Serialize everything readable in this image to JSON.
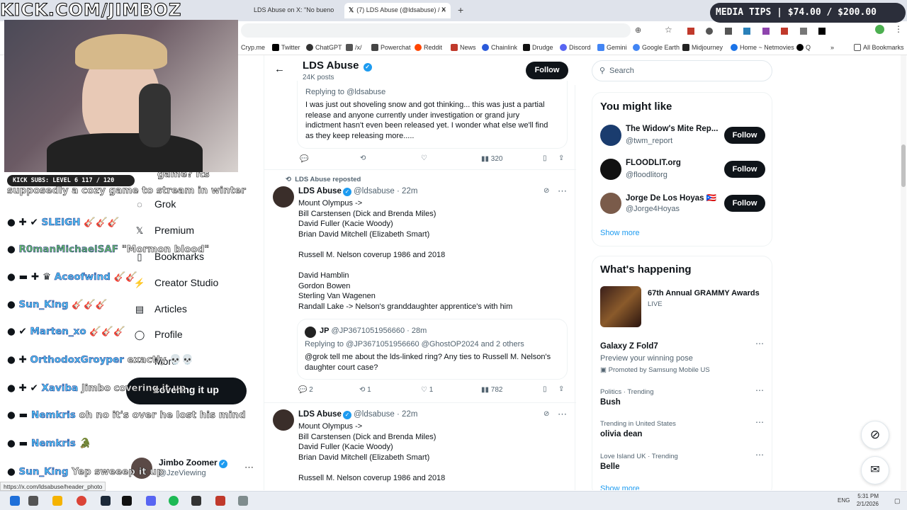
{
  "stream": {
    "title": "KICK.COM/JIMBOZ",
    "sub_goal": "KICK SUBS: LEVEL 6 117 / 120",
    "media_tips": "MEDIA TIPS | $74.00 / $200.00",
    "chat": [
      {
        "user": "",
        "msg": "supposedly a cozy game to stream in winter"
      },
      {
        "user": "SLEIGH",
        "msg": ""
      },
      {
        "user": "R0manMichaelSAF",
        "msg": "\"Mormon blood\""
      },
      {
        "user": "Aceofwind",
        "msg": ""
      },
      {
        "user": "Sun_King",
        "msg": ""
      },
      {
        "user": "Marten_xo",
        "msg": ""
      },
      {
        "user": "OrthodoxGroyper",
        "msg": "exactly 💀💀"
      },
      {
        "user": "Xaviba",
        "msg": "Jimbo covering it up"
      },
      {
        "user": "Nemkris",
        "msg": "oh no it's over he lost his mind"
      },
      {
        "user": "Nemkris",
        "msg": ""
      },
      {
        "user": "Sun_King",
        "msg": "Yep sweeep it up"
      }
    ],
    "chat_extra": "game? its",
    "pill": "covering it up"
  },
  "browser": {
    "tabs": [
      {
        "label": "LDS Abuse on X: \"No bueno"
      },
      {
        "label": "(7) LDS Abuse (@ldsabuse) / X"
      }
    ],
    "bookmarks": [
      "Cryp.me",
      "Twitter",
      "ChatGPT",
      "/x/",
      "Powerchat",
      "Reddit",
      "News",
      "Chainlink",
      "Drudge",
      "Discord",
      "Gemini",
      "Google Earth",
      "Midjourney",
      "Home ~ Netmovies",
      "Q",
      "All Bookmarks"
    ],
    "status_url": "https://x.com/ldsabuse/header_photo"
  },
  "nav": {
    "items": [
      "Grok",
      "Premium",
      "Bookmarks",
      "Creator Studio",
      "Articles",
      "Profile",
      "More"
    ],
    "account_name": "Jimbo Zoomer",
    "account_handle": "@JzeViewing"
  },
  "profile": {
    "name": "LDS Abuse",
    "posts": "24K posts",
    "follow_label": "Follow"
  },
  "tweet1": {
    "replying": "Replying to @ldsabuse",
    "text": [
      "I was just out shoveling snow and got thinking... this was just a partial",
      "release and anyone currently under investigation or grand jury",
      "indictment hasn't even been released yet. I wonder what else we'll find",
      "as they keep releasing more....."
    ],
    "views": "320"
  },
  "tweet2": {
    "reposted": "LDS Abuse reposted",
    "name": "LDS Abuse",
    "handle": "@ldsabuse · 22m",
    "lines": [
      "Mount Olympus ->",
      "Bill Carstensen (Dick and Brenda Miles)",
      "David Fuller (Kacie Woody)",
      "Brian David Mitchell (Elizabeth Smart)",
      "",
      "Russell M. Nelson coverup 1986 and 2018",
      "",
      "David Hamblin",
      "Gordon Bowen",
      "Sterling Van Wagenen",
      "Randall Lake -> Nelson's granddaughter apprentice's with him"
    ],
    "quote_name": "JP",
    "quote_handle": "@JP3671051956660 · 28m",
    "quote_replying": "Replying to @JP3671051956660 @GhostOP2024 and 2 others",
    "quote_text": [
      "@grok tell me about the lds-linked ring?  Any ties to Russell M. Nelson's",
      "daughter court case?"
    ],
    "replies": "2",
    "reposts": "1",
    "likes": "1",
    "views": "782"
  },
  "tweet3": {
    "name": "LDS Abuse",
    "handle": "@ldsabuse · 22m",
    "lines": [
      "Mount Olympus ->",
      "Bill Carstensen (Dick and Brenda Miles)",
      "David Fuller (Kacie Woody)",
      "Brian David Mitchell (Elizabeth Smart)",
      "",
      "Russell M. Nelson coverup 1986 and 2018"
    ]
  },
  "search": {
    "placeholder": "Search"
  },
  "might_like": {
    "title": "You might like",
    "users": [
      {
        "name": "The Widow's Mite Rep...",
        "handle": "@twm_report"
      },
      {
        "name": "FLOODLIT.org",
        "handle": "@floodlitorg"
      },
      {
        "name": "Jorge De Los Hoyas 🇵🇷",
        "handle": "@Jorge4Hoyas"
      }
    ],
    "follow_label": "Follow",
    "show_more": "Show more"
  },
  "happening": {
    "title": "What's happening",
    "featured_title": "67th Annual GRAMMY Awards",
    "featured_meta": "LIVE",
    "ad_title": "Galaxy Z Fold7",
    "ad_sub": "Preview your winning pose",
    "ad_promo": "Promoted by Samsung Mobile US",
    "trends": [
      {
        "meta": "Politics · Trending",
        "title": "Bush"
      },
      {
        "meta": "Trending in United States",
        "title": "olivia dean"
      },
      {
        "meta": "Love Island UK · Trending",
        "title": "Belle"
      }
    ],
    "show_more": "Show more"
  },
  "taskbar": {
    "lang": "ENG",
    "time": "5:31 PM",
    "date": "2/1/2026"
  },
  "colors": {
    "accent": "#1d9bf0",
    "dark": "#0f1419",
    "muted": "#536471"
  }
}
